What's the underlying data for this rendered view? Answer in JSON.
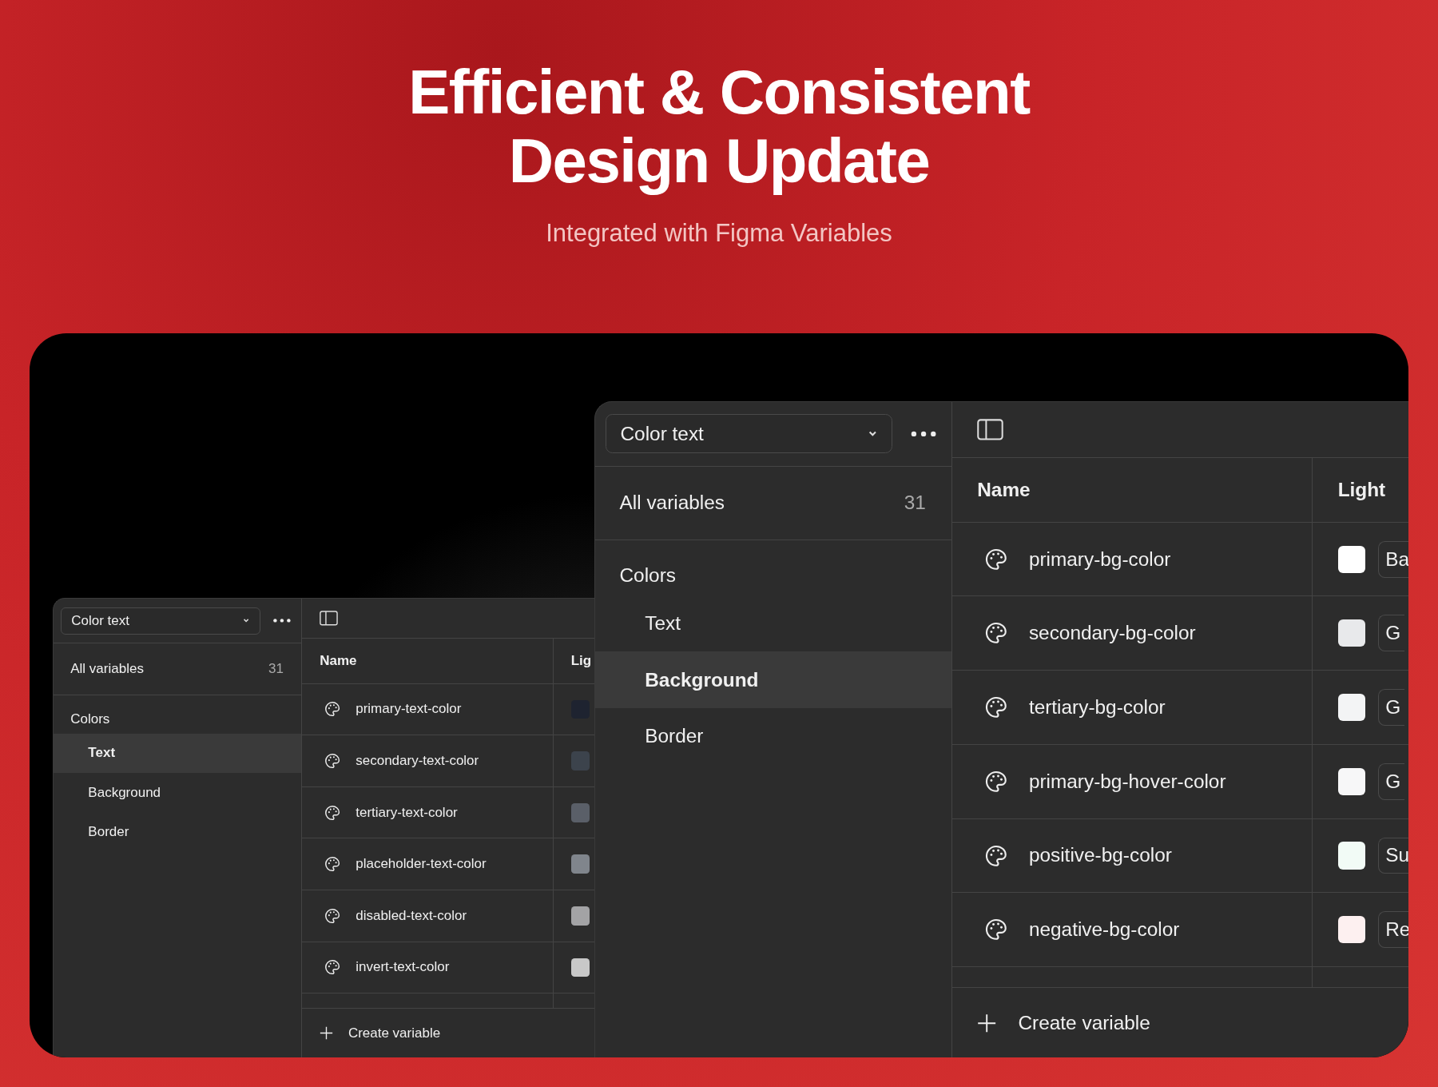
{
  "hero": {
    "title_lines": [
      "Efficient & Consistent",
      "Design Update"
    ],
    "subtitle": "Integrated with Figma Variables"
  },
  "panels": [
    {
      "collection": "Color text",
      "all_label": "All variables",
      "all_count": "31",
      "group": "Colors",
      "categories": [
        {
          "label": "Text",
          "selected": true
        },
        {
          "label": "Background",
          "selected": false
        },
        {
          "label": "Border",
          "selected": false
        }
      ],
      "columns": [
        "Name",
        "Lig"
      ],
      "rows": [
        {
          "name": "primary-text-color",
          "color": "#1e2330"
        },
        {
          "name": "secondary-text-color",
          "color": "#3c434c"
        },
        {
          "name": "tertiary-text-color",
          "color": "#5a5f68"
        },
        {
          "name": "placeholder-text-color",
          "color": "#80858c"
        },
        {
          "name": "disabled-text-color",
          "color": "#a3a3a5"
        },
        {
          "name": "invert-text-color",
          "color": "#c8c8c8"
        }
      ],
      "create_label": "Create variable"
    },
    {
      "collection": "Color text",
      "all_label": "All variables",
      "all_count": "31",
      "group": "Colors",
      "categories": [
        {
          "label": "Text",
          "selected": false
        },
        {
          "label": "Background",
          "selected": true
        },
        {
          "label": "Border",
          "selected": false
        }
      ],
      "columns": [
        "Name",
        "Light"
      ],
      "rows": [
        {
          "name": "primary-bg-color",
          "color": "#ffffff",
          "value": "Ba"
        },
        {
          "name": "secondary-bg-color",
          "color": "#e8e9eb",
          "value": "G"
        },
        {
          "name": "tertiary-bg-color",
          "color": "#f3f4f5",
          "value": "G"
        },
        {
          "name": "primary-bg-hover-color",
          "color": "#f7f7f8",
          "value": "G"
        },
        {
          "name": "positive-bg-color",
          "color": "#f2fbf6",
          "value": "Su"
        },
        {
          "name": "negative-bg-color",
          "color": "#fdf0f0",
          "value": "Re"
        }
      ],
      "create_label": "Create variable"
    }
  ]
}
